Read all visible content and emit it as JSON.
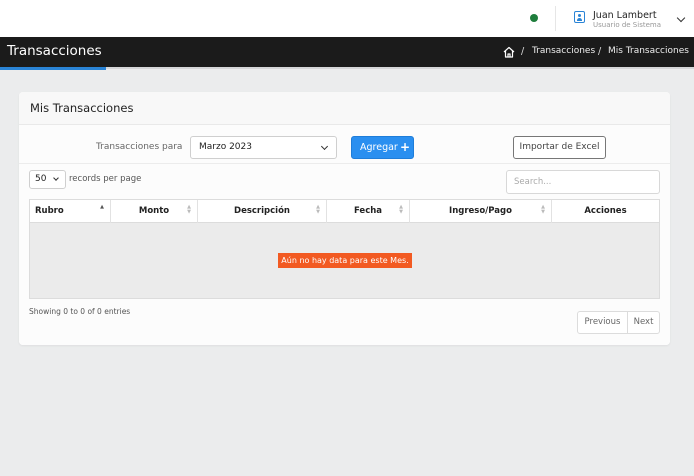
{
  "header": {
    "user_name": "Juan Lambert",
    "user_role": "Usuario de Sistema"
  },
  "titlebar": {
    "title": "Transacciones",
    "breadcrumb": [
      "Transacciones",
      "Mis Transacciones"
    ]
  },
  "card": {
    "title": "Mis Transacciones"
  },
  "filters": {
    "label": "Transacciones para",
    "month_selected": "Marzo 2023",
    "add_label": "Agregar",
    "import_label": "Importar de Excel"
  },
  "table_controls": {
    "per_page": "50",
    "per_page_label": "records per page",
    "search_placeholder": "Search..."
  },
  "table": {
    "columns": [
      "Rubro",
      "Monto",
      "Descripción",
      "Fecha",
      "Ingreso/Pago",
      "Acciones"
    ],
    "empty_message": "Aún no hay data para este Mes."
  },
  "footer": {
    "info": "Showing 0 to 0 of 0 entries",
    "prev_label": "Previous",
    "next_label": "Next"
  },
  "colors": {
    "accent": "#2a8ff0",
    "status_online": "#1e7d3c",
    "empty_badge": "#f25a22",
    "titlebar": "#1b1b1b"
  }
}
